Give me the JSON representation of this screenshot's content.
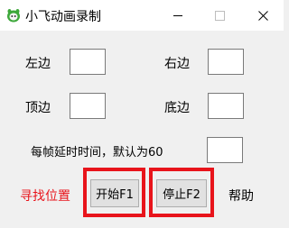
{
  "window": {
    "title": "小飞动画录制",
    "controls": {
      "minimize_icon": "minimize-icon",
      "maximize_icon": "maximize-icon",
      "close_icon": "close-icon"
    }
  },
  "fields": {
    "left": {
      "label": "左边",
      "value": ""
    },
    "right": {
      "label": "右边",
      "value": ""
    },
    "top": {
      "label": "顶边",
      "value": ""
    },
    "bottom": {
      "label": "底边",
      "value": ""
    },
    "delay": {
      "label": "每帧延时时间，默认为60",
      "value": ""
    }
  },
  "actions": {
    "find_position": "寻找位置",
    "start": "开始F1",
    "stop": "停止F2",
    "help": "帮助"
  },
  "colors": {
    "highlight": "#e8141b",
    "titlebar_bg": "#ffffff",
    "window_bg": "#f0f0f0"
  }
}
